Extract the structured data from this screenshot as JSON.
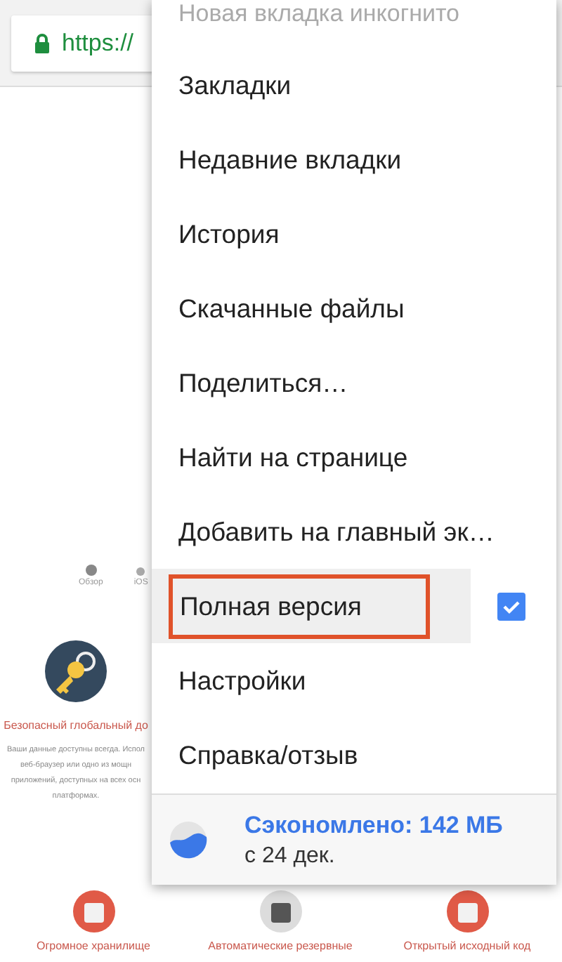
{
  "toolbar": {
    "url": "https://"
  },
  "site": {
    "tabs": [
      {
        "label": "Обзор"
      },
      {
        "label": "iOS"
      }
    ],
    "feature": {
      "title": "Безопасный глобальный до",
      "lines": [
        "Ваши данные доступны всегда. Испол",
        "веб-браузер или одно из мощн",
        "приложений, доступных на всех осн",
        "платформах."
      ]
    },
    "features_bottom": [
      {
        "title": "Огромное хранилище"
      },
      {
        "title": "Автоматические резервные"
      },
      {
        "title": "Открытый исходный код"
      }
    ]
  },
  "menu": {
    "items": [
      {
        "label": "Новая вкладка инкогнито",
        "kind": "faded",
        "highlighted": false
      },
      {
        "label": "Закладки",
        "kind": "plain",
        "highlighted": false
      },
      {
        "label": "Недавние вкладки",
        "kind": "plain",
        "highlighted": false
      },
      {
        "label": "История",
        "kind": "plain",
        "highlighted": false
      },
      {
        "label": "Скачанные файлы",
        "kind": "plain",
        "highlighted": false
      },
      {
        "label": "Поделиться…",
        "kind": "plain",
        "highlighted": false
      },
      {
        "label": "Найти на странице",
        "kind": "plain",
        "highlighted": false
      },
      {
        "label": "Добавить на главный эк…",
        "kind": "plain",
        "highlighted": false
      },
      {
        "label": "Полная версия",
        "kind": "checkbox",
        "checked": true,
        "highlighted": true
      },
      {
        "label": "Настройки",
        "kind": "plain",
        "highlighted": false
      },
      {
        "label": "Справка/отзыв",
        "kind": "plain",
        "highlighted": false
      }
    ],
    "footer": {
      "saved": "Сэкономлено: 142 МБ",
      "since": "с 24 дек."
    }
  }
}
